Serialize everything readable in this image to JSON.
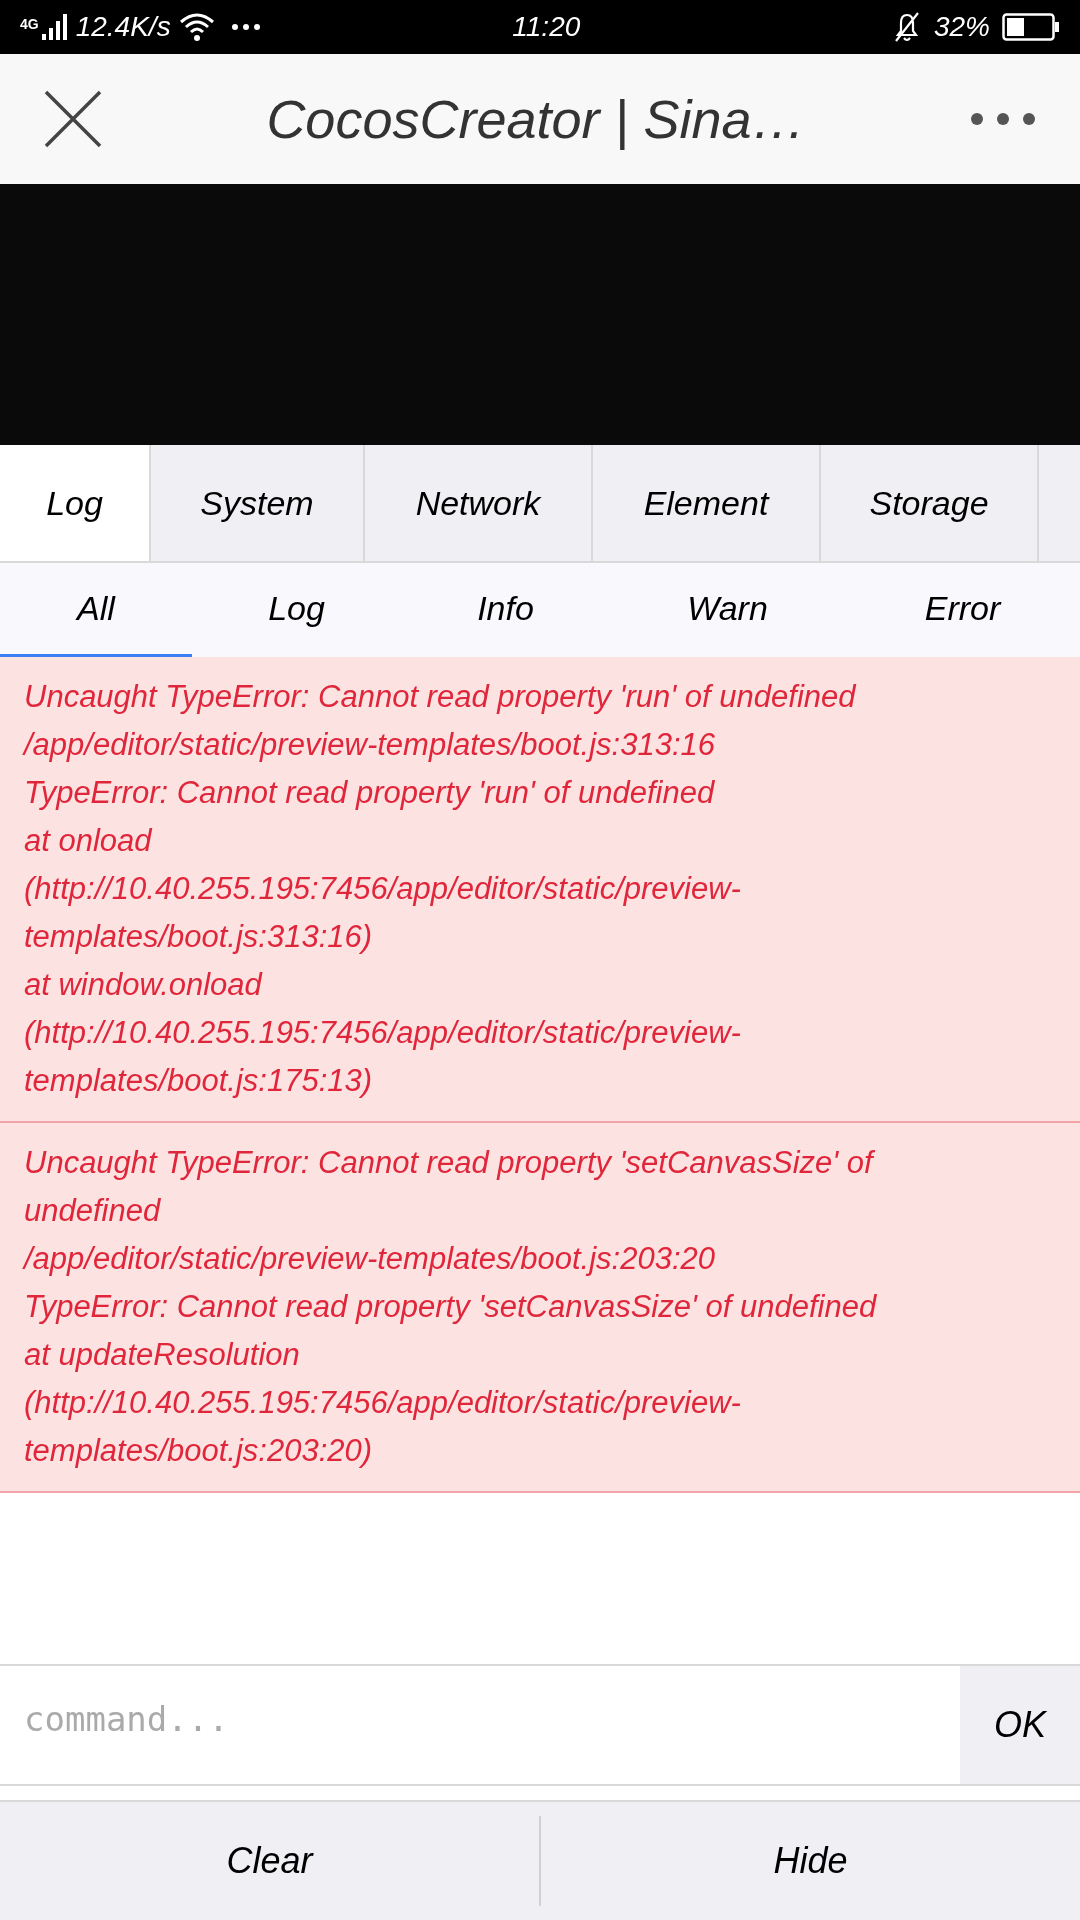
{
  "status_bar": {
    "network": "4G",
    "speed": "12.4K/s",
    "time": "11:20",
    "battery": "32%"
  },
  "header": {
    "title": "CocosCreator | Sina…"
  },
  "tabs": [
    {
      "label": "Log",
      "selected": true
    },
    {
      "label": "System",
      "selected": false
    },
    {
      "label": "Network",
      "selected": false
    },
    {
      "label": "Element",
      "selected": false
    },
    {
      "label": "Storage",
      "selected": false
    }
  ],
  "filters": [
    {
      "label": "All",
      "selected": true
    },
    {
      "label": "Log",
      "selected": false
    },
    {
      "label": "Info",
      "selected": false
    },
    {
      "label": "Warn",
      "selected": false
    },
    {
      "label": "Error",
      "selected": false
    }
  ],
  "log_entries": [
    {
      "kind": "error",
      "lines": [
        "Uncaught TypeError: Cannot read property 'run' of undefined",
        "/app/editor/static/preview-templates/boot.js:313:16",
        "TypeError: Cannot read property 'run' of undefined",
        "at onload",
        "(http://10.40.255.195:7456/app/editor/static/preview-",
        "templates/boot.js:313:16)",
        "at window.onload",
        "(http://10.40.255.195:7456/app/editor/static/preview-",
        "templates/boot.js:175:13)"
      ]
    },
    {
      "kind": "error",
      "lines": [
        "Uncaught TypeError: Cannot read property 'setCanvasSize' of",
        "undefined",
        "/app/editor/static/preview-templates/boot.js:203:20",
        "TypeError: Cannot read property 'setCanvasSize' of undefined",
        "at updateResolution",
        "(http://10.40.255.195:7456/app/editor/static/preview-",
        "templates/boot.js:203:20)"
      ]
    }
  ],
  "command": {
    "placeholder": "command...",
    "button": "OK"
  },
  "footer": [
    "Clear",
    "Hide"
  ]
}
